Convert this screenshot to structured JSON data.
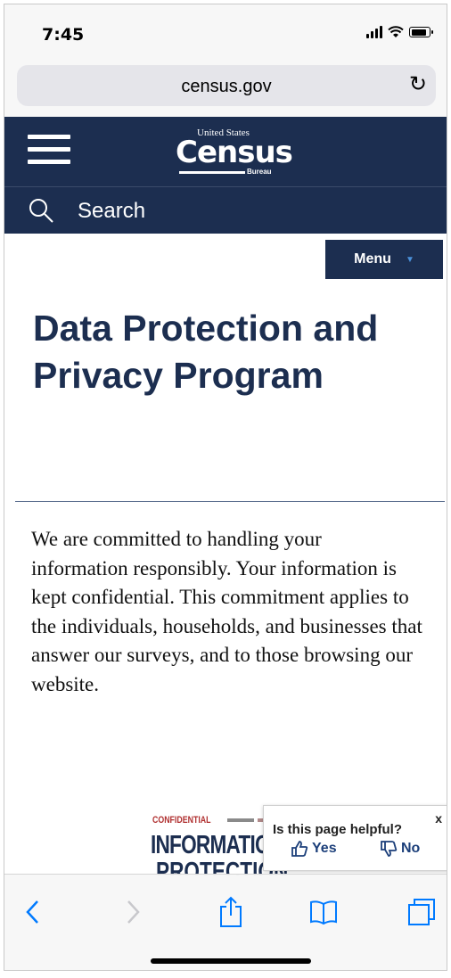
{
  "status_bar": {
    "time": "7:45"
  },
  "browser": {
    "url": "census.gov",
    "reload_glyph": "↻"
  },
  "site_header": {
    "logo": {
      "united_states": "United States",
      "census": "Census",
      "bureau": "Bureau"
    },
    "search_label": "Search"
  },
  "menu": {
    "label": "Menu",
    "caret": "▼"
  },
  "page": {
    "title": "Data Protection and Privacy Program",
    "intro": "We are committed to handling your information responsibly. Your information is kept confidential.  This commitment applies to the individuals, households, and businesses that answer our surveys, and to those browsing our website."
  },
  "image": {
    "alt_words": [
      "CONFIDENTIAL",
      "INFORMATION",
      "PROTECTION"
    ]
  },
  "feedback": {
    "question": "Is this page helpful?",
    "yes": "Yes",
    "no": "No",
    "close": "x"
  },
  "toolbar": {
    "icons": [
      "back-icon",
      "forward-icon",
      "share-icon",
      "bookmarks-icon",
      "tabs-icon"
    ]
  },
  "colors": {
    "navy": "#1c2e50",
    "link_blue": "#1c3f7a",
    "ios_blue": "#007aff"
  }
}
